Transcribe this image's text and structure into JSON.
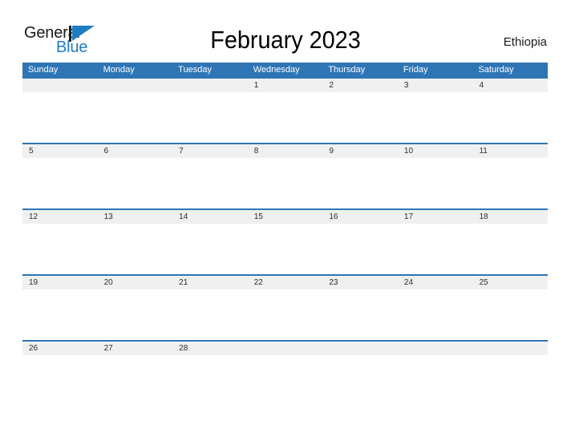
{
  "brand": {
    "name_part1": "General",
    "name_part2": "Blue",
    "triangle_icon": "blue-triangle-flag",
    "accent_color": "#1f7bc1"
  },
  "header": {
    "title": "February 2023",
    "country": "Ethiopia"
  },
  "colors": {
    "header_blue": "#2e75b6",
    "row_band_gray": "#f0f0f0",
    "logo_blue": "#1f7bc1",
    "text_dark": "#2b2b2b"
  },
  "calendar": {
    "month": "February",
    "year": "2023",
    "weekdays": [
      "Sunday",
      "Monday",
      "Tuesday",
      "Wednesday",
      "Thursday",
      "Friday",
      "Saturday"
    ],
    "weeks": [
      [
        "",
        "",
        "",
        "1",
        "2",
        "3",
        "4"
      ],
      [
        "5",
        "6",
        "7",
        "8",
        "9",
        "10",
        "11"
      ],
      [
        "12",
        "13",
        "14",
        "15",
        "16",
        "17",
        "18"
      ],
      [
        "19",
        "20",
        "21",
        "22",
        "23",
        "24",
        "25"
      ],
      [
        "26",
        "27",
        "28",
        "",
        "",
        "",
        ""
      ]
    ]
  }
}
